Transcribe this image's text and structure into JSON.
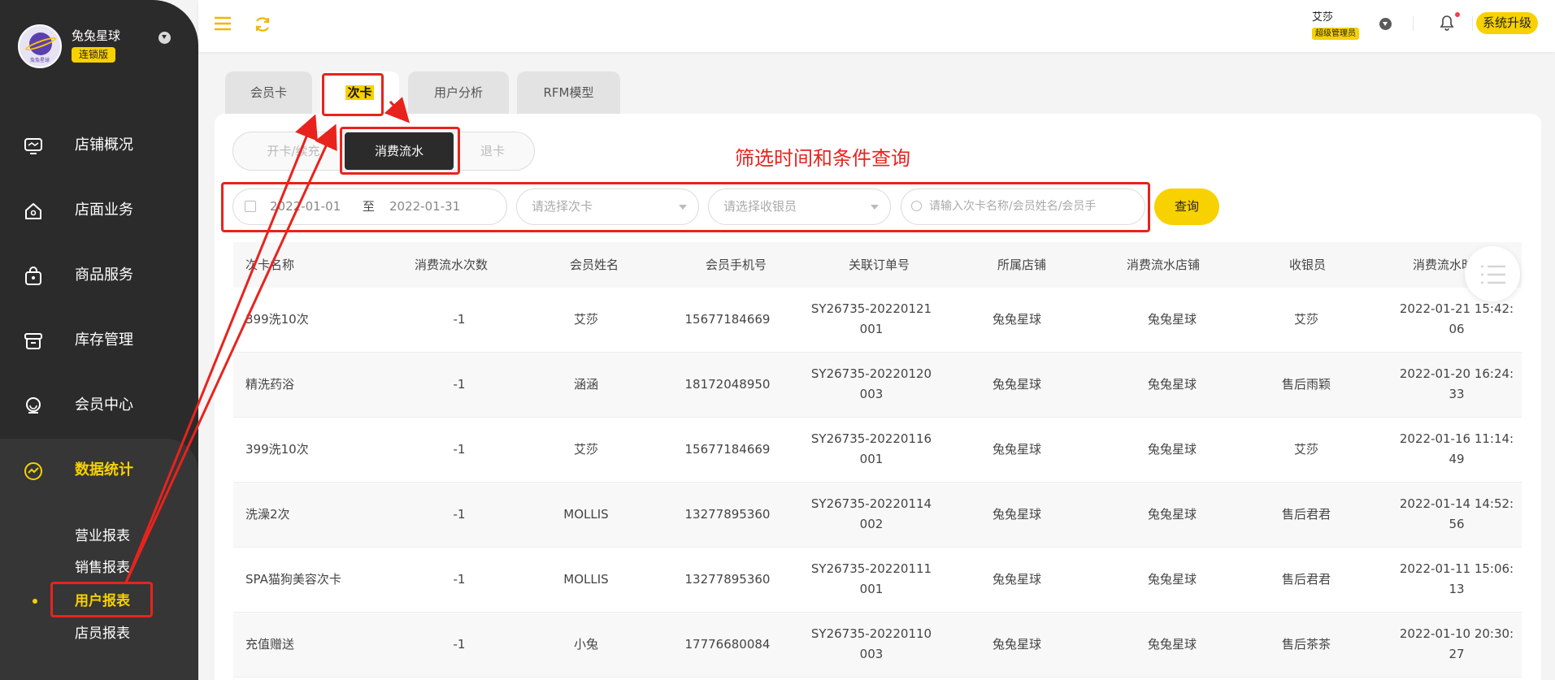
{
  "sidebar": {
    "brand_name": "兔兔星球",
    "brand_badge": "连锁版",
    "avatar_text": "兔兔星球",
    "items": [
      {
        "label": "店铺概况",
        "icon": "monitor-icon"
      },
      {
        "label": "店面业务",
        "icon": "house-icon"
      },
      {
        "label": "商品服务",
        "icon": "bag-icon"
      },
      {
        "label": "库存管理",
        "icon": "box-icon"
      },
      {
        "label": "会员中心",
        "icon": "member-icon"
      },
      {
        "label": "数据统计",
        "icon": "chart-icon"
      }
    ],
    "sub_items": [
      "营业报表",
      "销售报表",
      "用户报表",
      "店员报表"
    ],
    "active_sub": "用户报表"
  },
  "topbar": {
    "user_name": "艾莎",
    "user_role": "超级管理员",
    "upgrade_label": "系统升级"
  },
  "tabs": [
    "会员卡",
    "次卡",
    "用户分析",
    "RFM模型"
  ],
  "active_tab": "次卡",
  "segments": [
    "开卡/续充",
    "消费流水",
    "退卡"
  ],
  "active_segment": "消费流水",
  "filters": {
    "date_start": "2022-01-01",
    "date_sep": "至",
    "date_end": "2022-01-31",
    "card_placeholder": "请选择次卡",
    "cashier_placeholder": "请选择收银员",
    "search_placeholder": "请输入次卡名称/会员姓名/会员手",
    "query_label": "查询"
  },
  "annotation": "筛选时间和条件查询",
  "table": {
    "headers": [
      "次卡名称",
      "消费流水次数",
      "会员姓名",
      "会员手机号",
      "关联订单号",
      "所属店铺",
      "消费流水店铺",
      "收银员",
      "消费流水时"
    ],
    "rows": [
      {
        "name": "399洗10次",
        "count": "-1",
        "member": "艾莎",
        "phone": "15677184669",
        "order1": "SY26735-20220121",
        "order2": "001",
        "store": "兔兔星球",
        "store2": "兔兔星球",
        "cashier": "艾莎",
        "time1": "2022-01-21 15:42:",
        "time2": "06"
      },
      {
        "name": "精洗药浴",
        "count": "-1",
        "member": "涵涵",
        "phone": "18172048950",
        "order1": "SY26735-20220120",
        "order2": "003",
        "store": "兔兔星球",
        "store2": "兔兔星球",
        "cashier": "售后雨颖",
        "time1": "2022-01-20 16:24:",
        "time2": "33"
      },
      {
        "name": "399洗10次",
        "count": "-1",
        "member": "艾莎",
        "phone": "15677184669",
        "order1": "SY26735-20220116",
        "order2": "001",
        "store": "兔兔星球",
        "store2": "兔兔星球",
        "cashier": "艾莎",
        "time1": "2022-01-16 11:14:",
        "time2": "49"
      },
      {
        "name": "洗澡2次",
        "count": "-1",
        "member": "MOLLIS",
        "phone": "13277895360",
        "order1": "SY26735-20220114",
        "order2": "002",
        "store": "兔兔星球",
        "store2": "兔兔星球",
        "cashier": "售后君君",
        "time1": "2022-01-14 14:52:",
        "time2": "56"
      },
      {
        "name": "SPA猫狗美容次卡",
        "count": "-1",
        "member": "MOLLIS",
        "phone": "13277895360",
        "order1": "SY26735-20220111",
        "order2": "001",
        "store": "兔兔星球",
        "store2": "兔兔星球",
        "cashier": "售后君君",
        "time1": "2022-01-11 15:06:",
        "time2": "13"
      },
      {
        "name": "充值赠送",
        "count": "-1",
        "member": "小兔",
        "phone": "17776680084",
        "order1": "SY26735-20220110",
        "order2": "003",
        "store": "兔兔星球",
        "store2": "兔兔星球",
        "cashier": "售后茶茶",
        "time1": "2022-01-10 20:30:",
        "time2": "27"
      }
    ]
  },
  "colors": {
    "accent": "#f7d100",
    "sidebar": "#2b2b2b",
    "annotation": "#e8231d"
  }
}
